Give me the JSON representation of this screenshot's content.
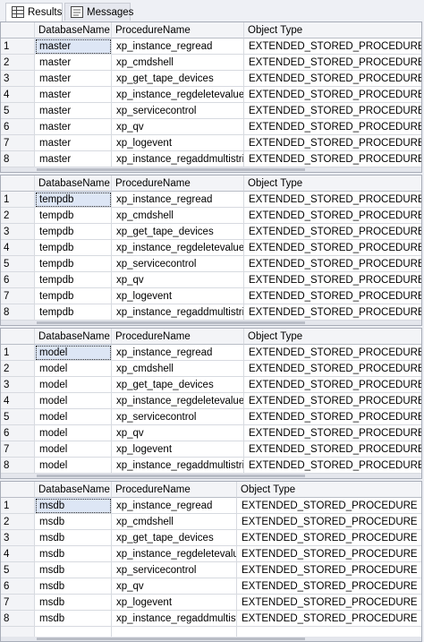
{
  "tabs": [
    {
      "label": "Results",
      "icon": "results-grid-icon",
      "active": true
    },
    {
      "label": "Messages",
      "icon": "messages-icon",
      "active": false
    }
  ],
  "columns": [
    "DatabaseName",
    "ProcedureName",
    "Object Type"
  ],
  "grids": [
    {
      "rows": [
        [
          "1",
          "master",
          "xp_instance_regread",
          "EXTENDED_STORED_PROCEDURE"
        ],
        [
          "2",
          "master",
          "xp_cmdshell",
          "EXTENDED_STORED_PROCEDURE"
        ],
        [
          "3",
          "master",
          "xp_get_tape_devices",
          "EXTENDED_STORED_PROCEDURE"
        ],
        [
          "4",
          "master",
          "xp_instance_regdeletevalue",
          "EXTENDED_STORED_PROCEDURE"
        ],
        [
          "5",
          "master",
          "xp_servicecontrol",
          "EXTENDED_STORED_PROCEDURE"
        ],
        [
          "6",
          "master",
          "xp_qv",
          "EXTENDED_STORED_PROCEDURE"
        ],
        [
          "7",
          "master",
          "xp_logevent",
          "EXTENDED_STORED_PROCEDURE"
        ],
        [
          "8",
          "master",
          "xp_instance_regaddmultistring",
          "EXTENDED_STORED_PROCEDURE"
        ]
      ]
    },
    {
      "rows": [
        [
          "1",
          "tempdb",
          "xp_instance_regread",
          "EXTENDED_STORED_PROCEDURE"
        ],
        [
          "2",
          "tempdb",
          "xp_cmdshell",
          "EXTENDED_STORED_PROCEDURE"
        ],
        [
          "3",
          "tempdb",
          "xp_get_tape_devices",
          "EXTENDED_STORED_PROCEDURE"
        ],
        [
          "4",
          "tempdb",
          "xp_instance_regdeletevalue",
          "EXTENDED_STORED_PROCEDURE"
        ],
        [
          "5",
          "tempdb",
          "xp_servicecontrol",
          "EXTENDED_STORED_PROCEDURE"
        ],
        [
          "6",
          "tempdb",
          "xp_qv",
          "EXTENDED_STORED_PROCEDURE"
        ],
        [
          "7",
          "tempdb",
          "xp_logevent",
          "EXTENDED_STORED_PROCEDURE"
        ],
        [
          "8",
          "tempdb",
          "xp_instance_regaddmultistring",
          "EXTENDED_STORED_PROCEDURE"
        ]
      ]
    },
    {
      "rows": [
        [
          "1",
          "model",
          "xp_instance_regread",
          "EXTENDED_STORED_PROCEDURE"
        ],
        [
          "2",
          "model",
          "xp_cmdshell",
          "EXTENDED_STORED_PROCEDURE"
        ],
        [
          "3",
          "model",
          "xp_get_tape_devices",
          "EXTENDED_STORED_PROCEDURE"
        ],
        [
          "4",
          "model",
          "xp_instance_regdeletevalue",
          "EXTENDED_STORED_PROCEDURE"
        ],
        [
          "5",
          "model",
          "xp_servicecontrol",
          "EXTENDED_STORED_PROCEDURE"
        ],
        [
          "6",
          "model",
          "xp_qv",
          "EXTENDED_STORED_PROCEDURE"
        ],
        [
          "7",
          "model",
          "xp_logevent",
          "EXTENDED_STORED_PROCEDURE"
        ],
        [
          "8",
          "model",
          "xp_instance_regaddmultistring",
          "EXTENDED_STORED_PROCEDURE"
        ]
      ]
    },
    {
      "rows": [
        [
          "1",
          "msdb",
          "xp_instance_regread",
          "EXTENDED_STORED_PROCEDURE"
        ],
        [
          "2",
          "msdb",
          "xp_cmdshell",
          "EXTENDED_STORED_PROCEDURE"
        ],
        [
          "3",
          "msdb",
          "xp_get_tape_devices",
          "EXTENDED_STORED_PROCEDURE"
        ],
        [
          "4",
          "msdb",
          "xp_instance_regdeletevalue",
          "EXTENDED_STORED_PROCEDURE"
        ],
        [
          "5",
          "msdb",
          "xp_servicecontrol",
          "EXTENDED_STORED_PROCEDURE"
        ],
        [
          "6",
          "msdb",
          "xp_qv",
          "EXTENDED_STORED_PROCEDURE"
        ],
        [
          "7",
          "msdb",
          "xp_logevent",
          "EXTENDED_STORED_PROCEDURE"
        ],
        [
          "8",
          "msdb",
          "xp_instance_regaddmultist...",
          "EXTENDED_STORED_PROCEDURE"
        ]
      ]
    }
  ],
  "colors": {
    "selected_cell": "#dde6f5",
    "header_bg": "#f3f4f7",
    "grid_line": "#d7dae0"
  }
}
